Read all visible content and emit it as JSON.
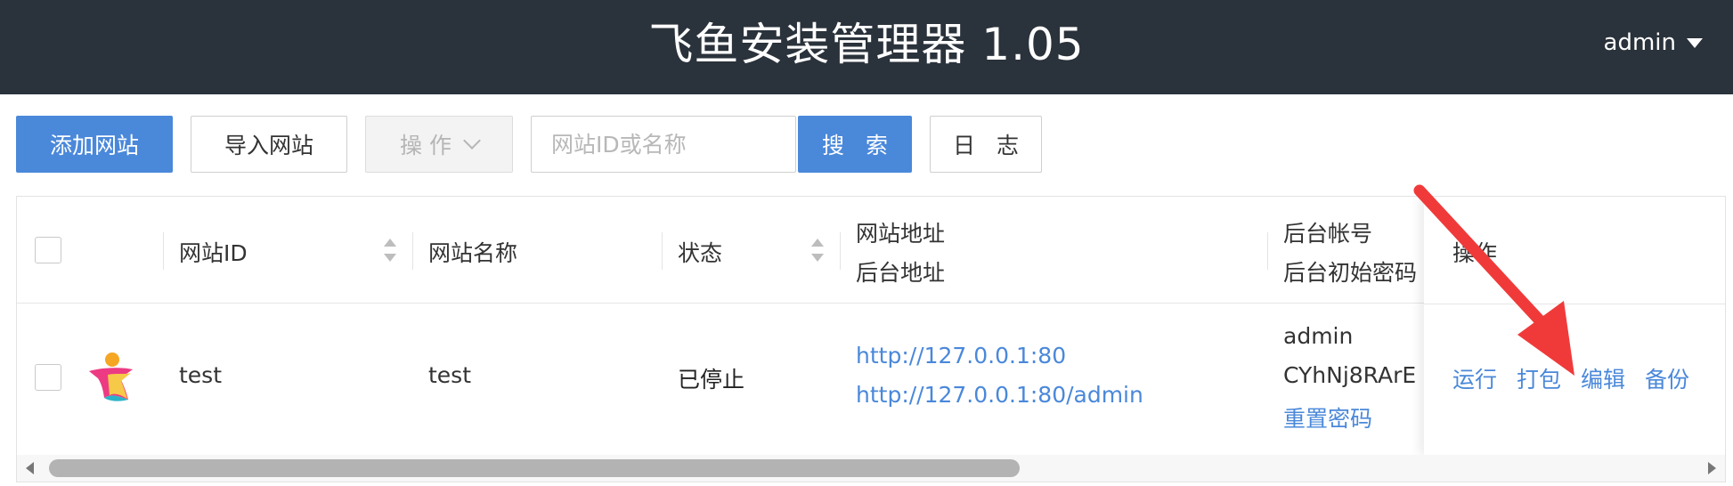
{
  "header": {
    "title": "飞鱼安装管理器 1.05",
    "user": "admin"
  },
  "toolbar": {
    "add_site": "添加网站",
    "import_site": "导入网站",
    "operations": "操 作",
    "search_placeholder": "网站ID或名称",
    "search": "搜 索",
    "log": "日 志"
  },
  "table": {
    "columns": {
      "site_id": "网站ID",
      "site_name": "网站名称",
      "status": "状态",
      "site_url": "网站地址",
      "admin_url": "后台地址",
      "admin_account": "后台帐号",
      "admin_password": "后台初始密码",
      "operations": "操作"
    },
    "rows": [
      {
        "site_id": "test",
        "site_name": "test",
        "status": "已停止",
        "site_url": "http://127.0.0.1:80",
        "admin_url": "http://127.0.0.1:80/admin",
        "account": "admin",
        "password": "CYhNj8RArE",
        "reset_password": "重置密码",
        "actions": {
          "run": "运行",
          "pack": "打包",
          "edit": "编辑",
          "backup": "备份"
        }
      }
    ]
  },
  "colors": {
    "header_bg": "#2a323b",
    "primary": "#4a88da",
    "annotation_arrow": "#f03a3a"
  },
  "icons": {
    "site_logo": "star-person-logo-icon",
    "annotation": "red-arrow-annotation"
  }
}
